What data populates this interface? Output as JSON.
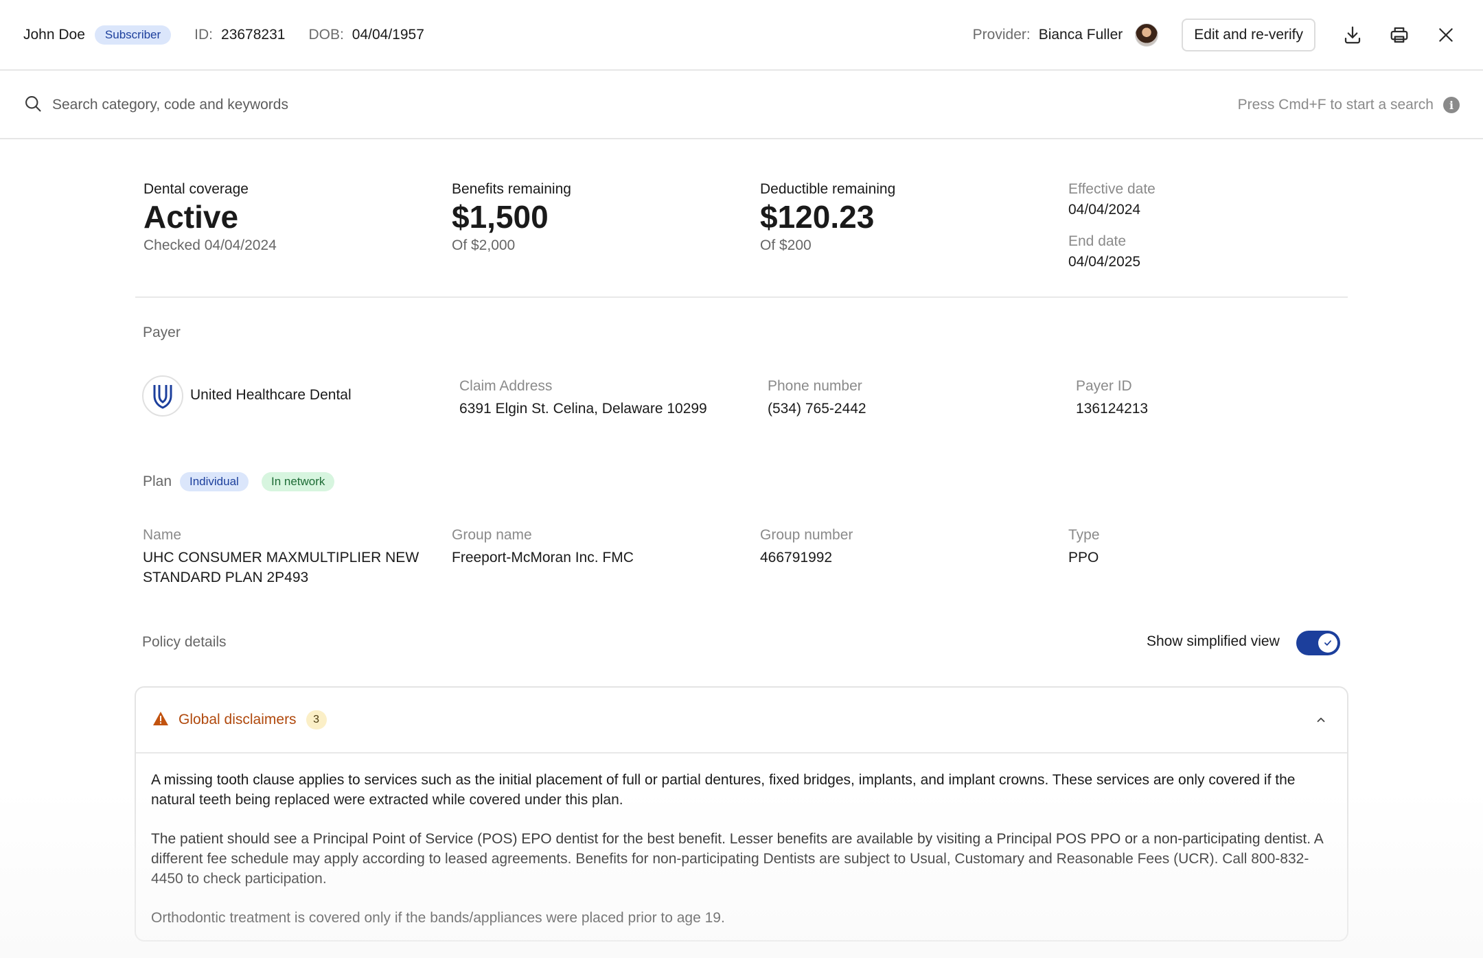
{
  "header": {
    "patient_name": "John Doe",
    "subscriber_badge": "Subscriber",
    "id_label": "ID:",
    "id_value": "23678231",
    "dob_label": "DOB:",
    "dob_value": "04/04/1957",
    "provider_label": "Provider:",
    "provider_name": "Bianca Fuller",
    "edit_button": "Edit and re-verify",
    "icons": [
      "download-icon",
      "print-icon",
      "close-icon"
    ]
  },
  "search": {
    "placeholder": "Search category, code and keywords",
    "hint": "Press Cmd+F to start a search",
    "info_glyph": "i"
  },
  "coverage": {
    "dental_coverage": {
      "label": "Dental coverage",
      "value": "Active",
      "sub": "Checked 04/04/2024"
    },
    "benefits_remaining": {
      "label": "Benefits remaining",
      "value": "$1,500",
      "sub": "Of $2,000"
    },
    "deductible_remaining": {
      "label": "Deductible remaining",
      "value": "$120.23",
      "sub": "Of $200"
    },
    "effective_date": {
      "label": "Effective date",
      "value": "04/04/2024"
    },
    "end_date": {
      "label": "End date",
      "value": "04/04/2025"
    }
  },
  "payer": {
    "section_label": "Payer",
    "name": "United Healthcare Dental",
    "claim_address": {
      "label": "Claim Address",
      "value": "6391 Elgin St. Celina, Delaware 10299"
    },
    "phone_number": {
      "label": "Phone number",
      "value": "(534) 765-2442"
    },
    "payer_id": {
      "label": "Payer ID",
      "value": "136124213"
    }
  },
  "plan": {
    "section_label": "Plan",
    "badges": [
      "Individual",
      "In network"
    ],
    "name": {
      "label": "Name",
      "value": "UHC CONSUMER MAXMULTIPLIER NEW STANDARD PLAN 2P493"
    },
    "group_name": {
      "label": "Group name",
      "value": "Freeport-McMoran Inc. FMC"
    },
    "group_number": {
      "label": "Group number",
      "value": "466791992"
    },
    "type": {
      "label": "Type",
      "value": "PPO"
    }
  },
  "policy": {
    "section_label": "Policy details",
    "toggle_label": "Show simplified view",
    "toggle_on": true
  },
  "disclaimers": {
    "title": "Global disclaimers",
    "count": "3",
    "items": [
      "A missing tooth clause applies to services such as the initial placement of full or partial dentures, fixed bridges, implants, and implant crowns. These services are only covered if the natural teeth being replaced were extracted while covered under this plan.",
      "The patient should see a Principal Point of Service (POS) EPO dentist for the best benefit. Lesser benefits are available by visiting a Principal POS PPO or a non-participating dentist. A different fee schedule may apply according to leased agreements. Benefits for non-participating Dentists are subject to Usual, Customary and Reasonable Fees (UCR). Call 800-832-4450 to check participation.",
      "Orthodontic treatment is covered only if the bands/appliances were placed prior to age 19."
    ]
  },
  "colors": {
    "brand_blue": "#1c3f9c",
    "warning_orange": "#b0490d",
    "network_green": "#1d6b35"
  }
}
